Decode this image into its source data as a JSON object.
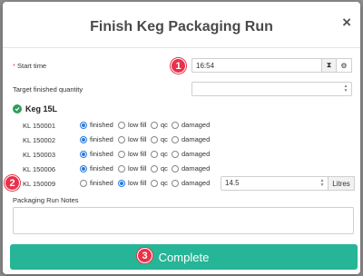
{
  "dialog": {
    "title": "Finish Keg Packaging Run",
    "close_glyph": "×"
  },
  "start_time": {
    "required_mark": "*",
    "label": "Start time",
    "value": "16:54",
    "hourglass_icon": "⧗",
    "settings_icon": "⚙"
  },
  "target_quantity": {
    "label": "Target finished quantity",
    "value": ""
  },
  "keg_section": {
    "title": "Keg 15L",
    "options": [
      "finished",
      "low fill",
      "qc",
      "damaged"
    ],
    "rows": [
      {
        "id": "KL 150001",
        "selected": "finished"
      },
      {
        "id": "KL 150002",
        "selected": "finished"
      },
      {
        "id": "KL 150003",
        "selected": "finished"
      },
      {
        "id": "KL 150006",
        "selected": "finished"
      },
      {
        "id": "KL 150009",
        "selected": "low fill",
        "amount": "14.5",
        "unit": "Litres"
      }
    ]
  },
  "notes": {
    "label": "Packaging Run Notes",
    "value": ""
  },
  "badges": {
    "one": "1",
    "two": "2",
    "three": "3"
  },
  "complete_button": {
    "label": "Complete"
  },
  "colors": {
    "accent": "#26b597",
    "badge": "#e8314a",
    "radio": "#2a7ae2"
  }
}
